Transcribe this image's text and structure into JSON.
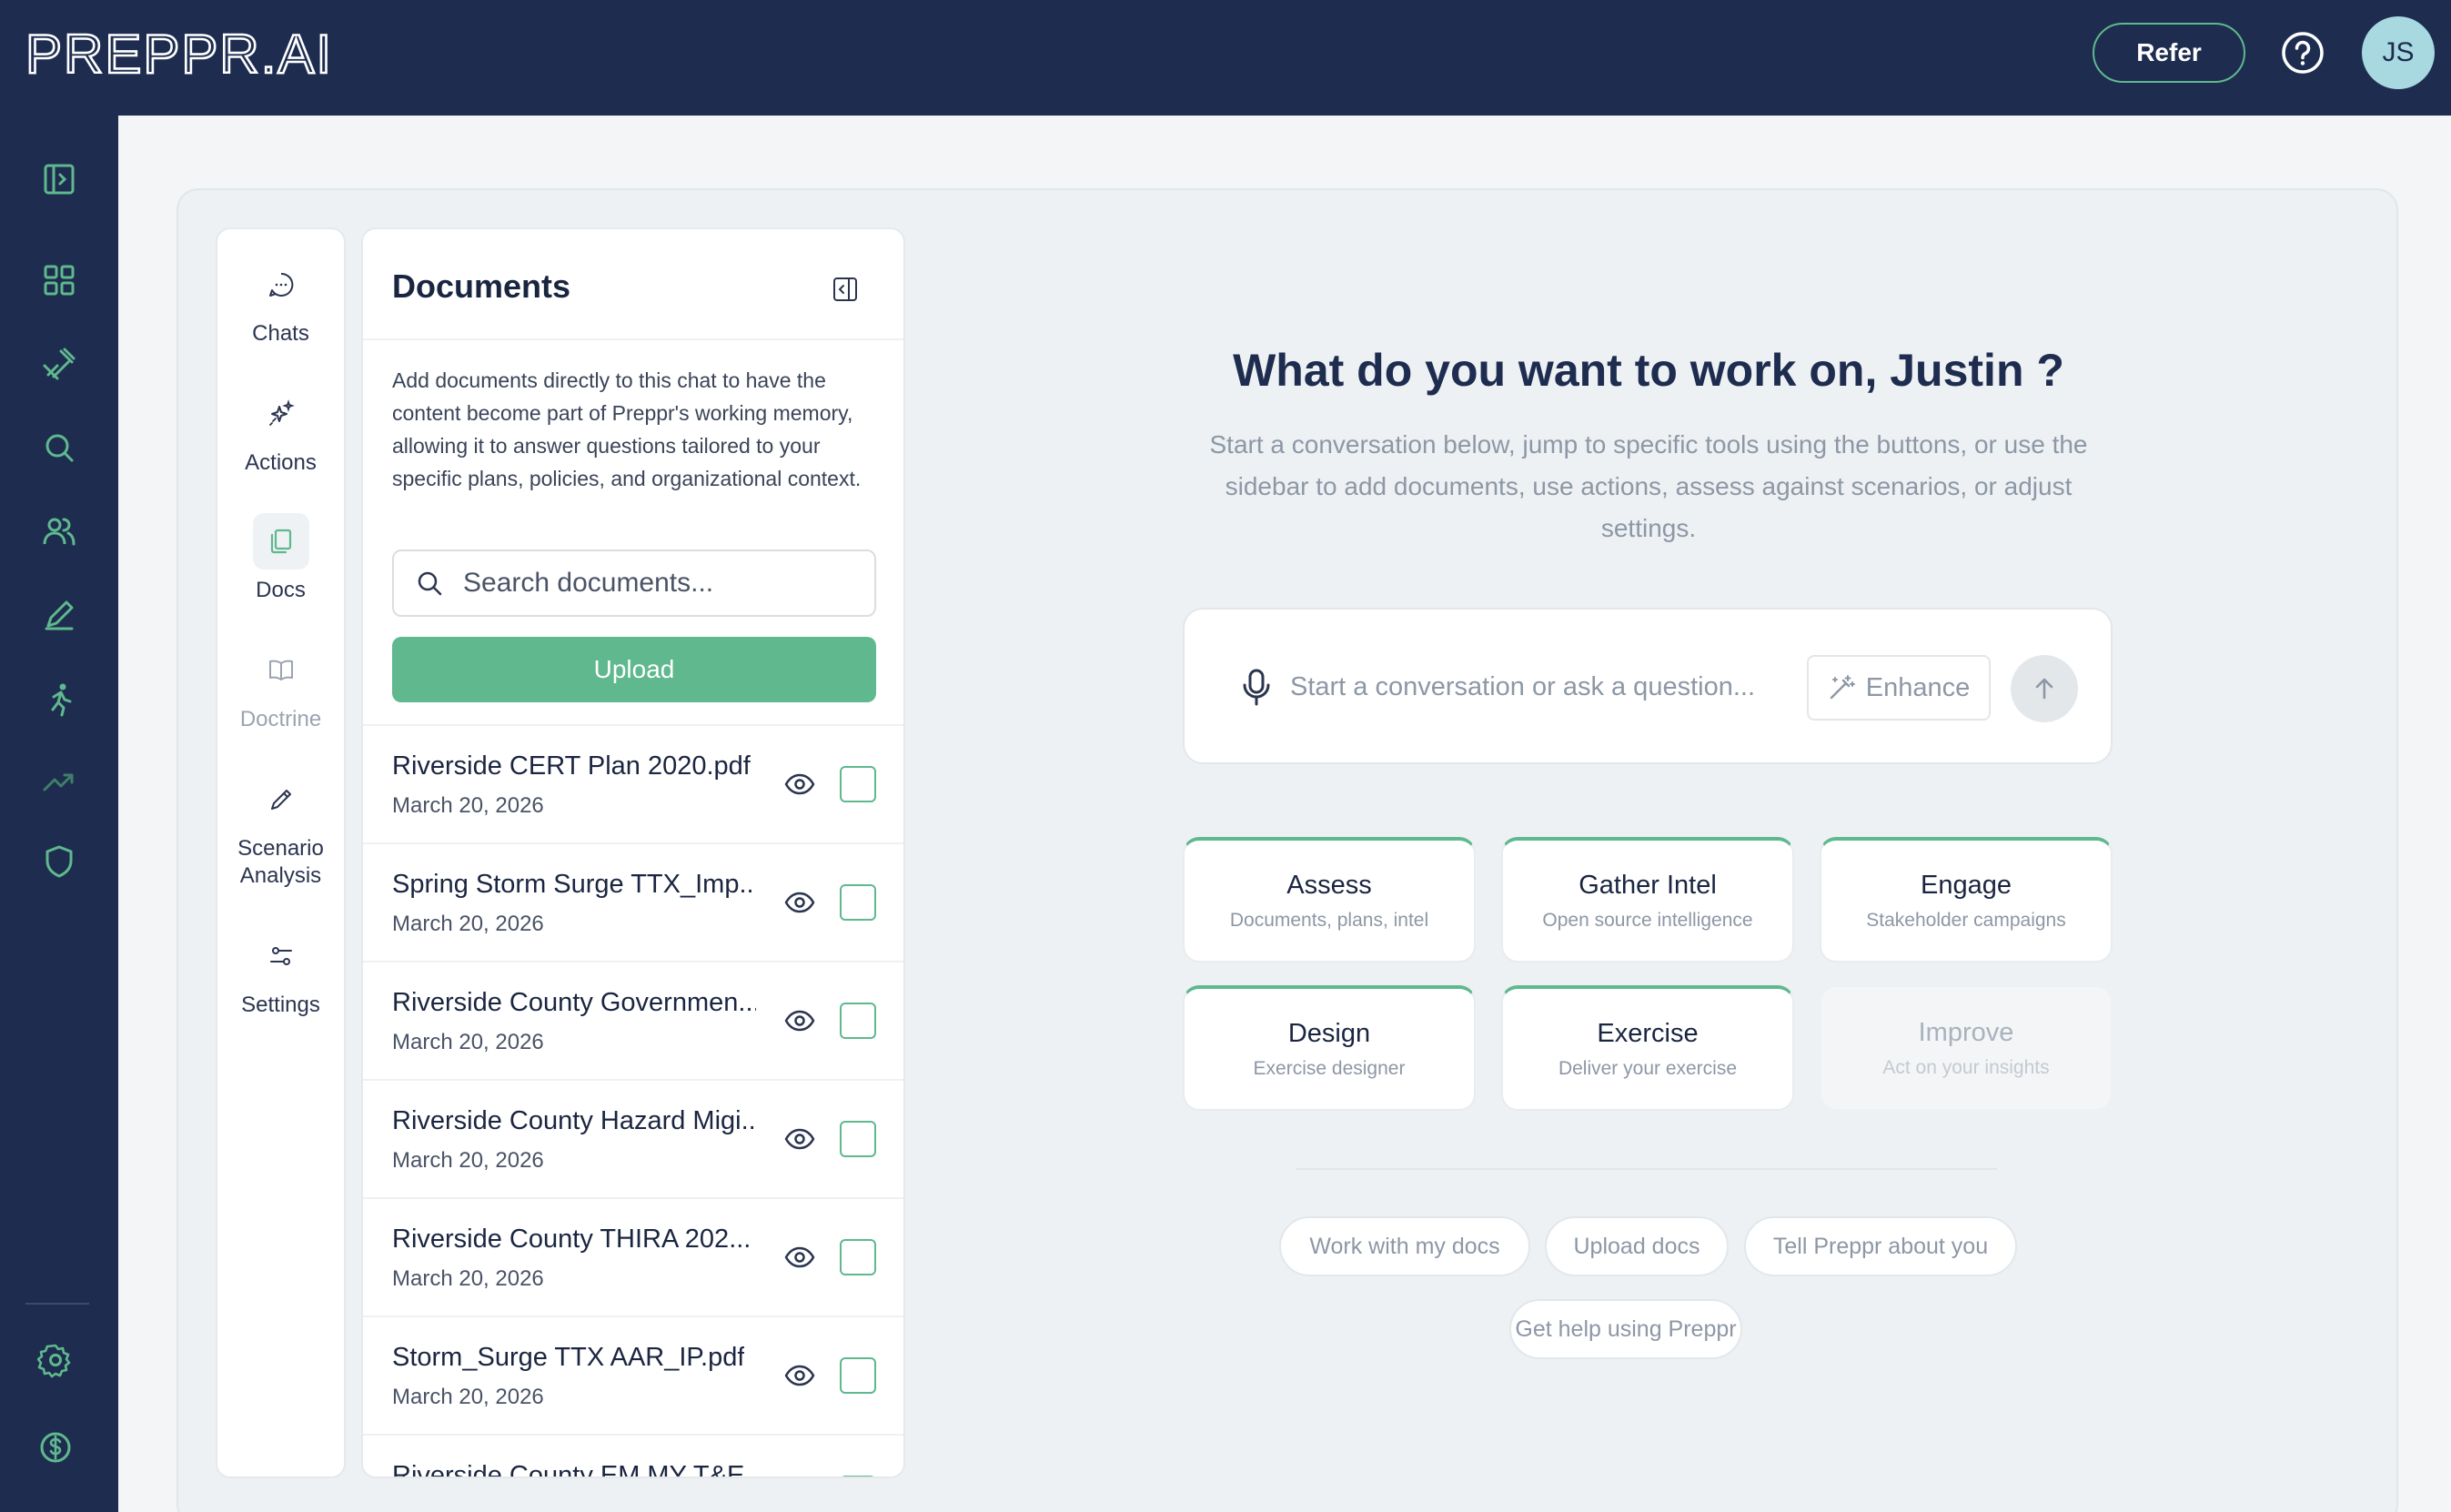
{
  "header": {
    "logo_text": "PREPPR.AI",
    "refer_label": "Refer",
    "avatar_initials": "JS"
  },
  "rail": {
    "items": [
      "sidebar-toggle-icon",
      "dashboard-icon",
      "tools-icon",
      "search-icon",
      "users-icon",
      "pen-icon",
      "runner-icon",
      "trending-icon",
      "shield-icon",
      "gear-icon",
      "dollar-icon"
    ]
  },
  "tools": [
    {
      "label": "Chats",
      "icon": "chat-bubble-icon"
    },
    {
      "label": "Actions",
      "icon": "sparkles-icon"
    },
    {
      "label": "Docs",
      "icon": "documents-icon"
    },
    {
      "label": "Doctrine",
      "icon": "book-icon"
    },
    {
      "label": "Scenario\nAnalysis",
      "icon": "pencil-icon"
    },
    {
      "label": "Settings",
      "icon": "sliders-icon"
    }
  ],
  "documents": {
    "title": "Documents",
    "description": "Add documents directly to this chat to have the content become part of Preppr's working memory, allowing it to answer questions tailored to your specific plans, policies, and organizational context.",
    "search_placeholder": "Search documents...",
    "upload_label": "Upload",
    "items": [
      {
        "name": "Riverside CERT Plan 2020.pdf",
        "date": "March 20, 2026"
      },
      {
        "name": "Spring Storm Surge TTX_Imp...",
        "date": "March 20, 2026"
      },
      {
        "name": "Riverside County Governmen...",
        "date": "March 20, 2026"
      },
      {
        "name": "Riverside County Hazard Migi...",
        "date": "March 20, 2026"
      },
      {
        "name": "Riverside County THIRA 202...",
        "date": "March 20, 2026"
      },
      {
        "name": "Storm_Surge TTX AAR_IP.pdf",
        "date": "March 20, 2026"
      },
      {
        "name": "Riverside County EM MY T&E...",
        "date": ""
      }
    ]
  },
  "hero": {
    "title": "What do you want to work on, Justin ?",
    "subtitle": "Start a conversation below, jump to specific tools using the buttons, or use the sidebar to add documents, use actions, assess against scenarios, or adjust settings.",
    "input_placeholder": "Start a conversation or ask a question...",
    "enhance_label": "Enhance"
  },
  "tiles": [
    {
      "title": "Assess",
      "subtitle": "Documents, plans, intel",
      "enabled": true
    },
    {
      "title": "Gather Intel",
      "subtitle": "Open source intelligence",
      "enabled": true
    },
    {
      "title": "Engage",
      "subtitle": "Stakeholder campaigns",
      "enabled": true
    },
    {
      "title": "Design",
      "subtitle": "Exercise designer",
      "enabled": true
    },
    {
      "title": "Exercise",
      "subtitle": "Deliver your exercise",
      "enabled": true
    },
    {
      "title": "Improve",
      "subtitle": "Act on your insights",
      "enabled": false
    }
  ],
  "chips": [
    "Work with my docs",
    "Upload docs",
    "Tell Preppr about you",
    "Get help using Preppr"
  ],
  "colors": {
    "navy": "#1e2d4f",
    "accent_green": "#5fb88e",
    "muted_text": "#8d97a5"
  }
}
